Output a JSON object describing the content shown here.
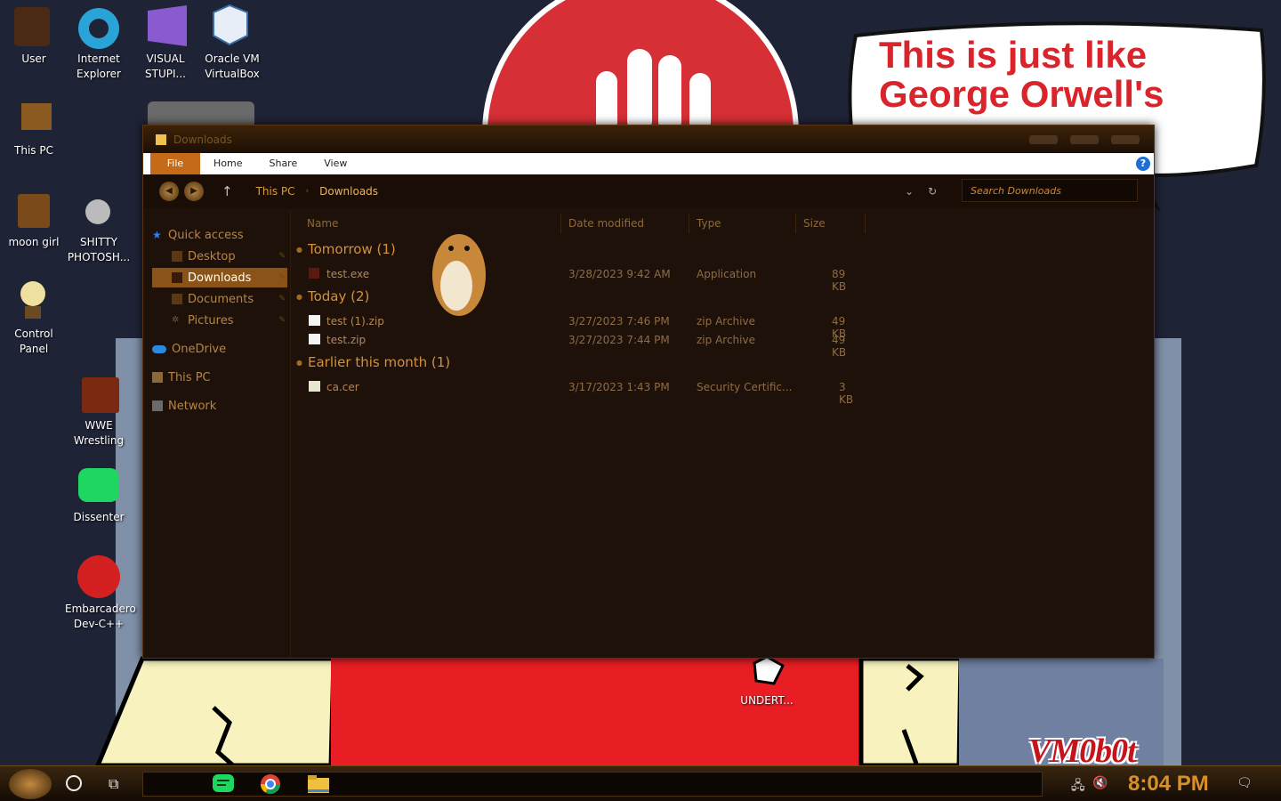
{
  "wallpaper": {
    "speech_bubble_text": "This is just like George Orwell's",
    "watermark": "VM0b0t"
  },
  "desktop_icons": [
    {
      "label": "User"
    },
    {
      "label": "Internet\nExplorer"
    },
    {
      "label": "VISUAL\nSTUPI..."
    },
    {
      "label": "Oracle VM\nVirtualBox"
    },
    {
      "label": "This PC"
    },
    {
      "label": "moon girl"
    },
    {
      "label": "SHITTY\nPHOTOSH..."
    },
    {
      "label": "Control\nPanel"
    },
    {
      "label": "WWE\nWrestling"
    },
    {
      "label": "Dissenter"
    },
    {
      "label": "Embarcadero\nDev-C++"
    },
    {
      "label": "UNDERT..."
    }
  ],
  "explorer": {
    "title": "Downloads",
    "ribbon_tabs": [
      "File",
      "Home",
      "Share",
      "View"
    ],
    "help": "?",
    "breadcrumb": [
      "This PC",
      "Downloads"
    ],
    "search_placeholder": "Search Downloads",
    "nav": {
      "quick_access": "Quick access",
      "desktop": "Desktop",
      "downloads": "Downloads",
      "documents": "Documents",
      "pictures": "Pictures",
      "onedrive": "OneDrive",
      "this_pc": "This PC",
      "network": "Network"
    },
    "columns": [
      "Name",
      "Date modified",
      "Type",
      "Size"
    ],
    "groups": [
      {
        "label": "Tomorrow (1)",
        "files": [
          {
            "name": "test.exe",
            "date": "3/28/2023 9:42 AM",
            "type": "Application",
            "size": "89 KB"
          }
        ]
      },
      {
        "label": "Today (2)",
        "files": [
          {
            "name": "test (1).zip",
            "date": "3/27/2023 7:46 PM",
            "type": "zip Archive",
            "size": "49 KB"
          },
          {
            "name": "test.zip",
            "date": "3/27/2023 7:44 PM",
            "type": "zip Archive",
            "size": "49 KB"
          }
        ]
      },
      {
        "label": "Earlier this month (1)",
        "files": [
          {
            "name": "ca.cer",
            "date": "3/17/2023 1:43 PM",
            "type": "Security Certific...",
            "size": "3 KB"
          }
        ]
      }
    ]
  },
  "taskbar": {
    "apps": [
      "dissenter-icon",
      "chrome-icon",
      "file-explorer-icon"
    ],
    "clock": "8:04 PM"
  },
  "colors": {
    "accent": "#c46a18",
    "window_bg": "#1e110a",
    "group_text": "#d1913f",
    "clock": "#d8902a"
  }
}
